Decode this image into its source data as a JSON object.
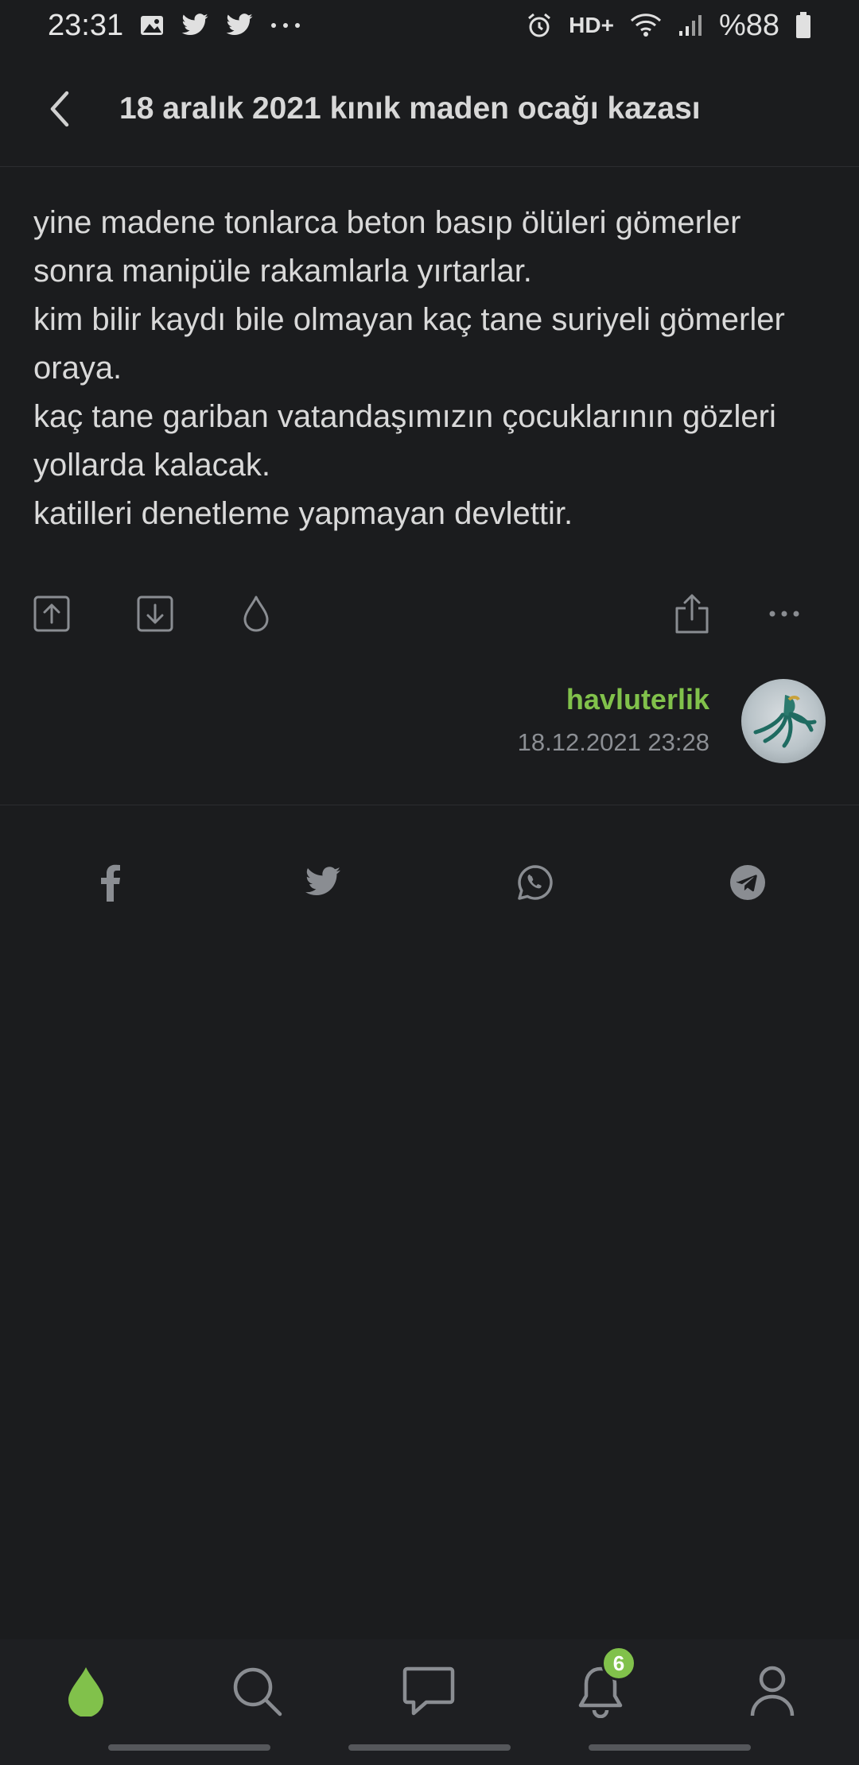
{
  "status_bar": {
    "time": "23:31",
    "network": "HD+",
    "battery": "%88",
    "icons": [
      "gallery-icon",
      "twitter-icon",
      "twitter-icon",
      "more-icon",
      "alarm-icon",
      "wifi-icon",
      "signal-icon",
      "battery-icon"
    ]
  },
  "header": {
    "title": "18 aralık 2021 kınık maden ocağı kazası",
    "back_icon": "chevron-left-icon"
  },
  "entry": {
    "lines": [
      "yine madene tonlarca beton basıp ölüleri gömerler sonra manipüle rakamlarla yırtarlar.",
      "kim bilir kaydı bile olmayan kaç tane suriyeli gömerler oraya.",
      "kaç tane gariban vatandaşımızın çocuklarının gözleri yollarda kalacak.",
      "katilleri denetleme yapmayan devlettir."
    ]
  },
  "actions": {
    "items": [
      "upvote-icon",
      "downvote-icon",
      "drop-icon",
      "share-icon",
      "more-icon"
    ]
  },
  "author": {
    "name": "havluterlik",
    "date": "18.12.2021 23:28"
  },
  "share": {
    "items": [
      "facebook-icon",
      "twitter-icon",
      "whatsapp-icon",
      "telegram-icon"
    ]
  },
  "bottom_nav": {
    "items": [
      "home-drop-icon",
      "search-icon",
      "messages-icon",
      "notifications-icon",
      "profile-icon"
    ],
    "notification_count": "6"
  },
  "colors": {
    "background": "#1b1c1e",
    "accent": "#81c14b",
    "icon": "#8a8d92"
  }
}
